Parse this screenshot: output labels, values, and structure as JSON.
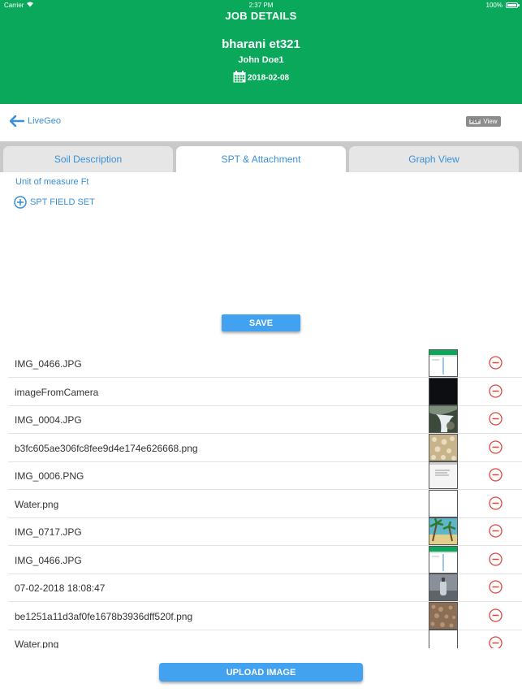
{
  "status_bar": {
    "carrier": "Carrier",
    "time": "2:37 PM",
    "battery": "100%"
  },
  "header": {
    "title": "JOB DETAILS",
    "job_name": "bharani et321",
    "user": "John Doe1",
    "date": "2018-02-08"
  },
  "nav": {
    "back_label": "LiveGeo",
    "pdf_label": "PDF",
    "view_label": "View"
  },
  "tabs": [
    {
      "label": "Soil Description",
      "active": false
    },
    {
      "label": "SPT & Attachment",
      "active": true
    },
    {
      "label": "Graph View",
      "active": false
    }
  ],
  "unit_label": "Unit of measure Ft",
  "spt_field_set_label": "SPT FIELD SET",
  "save_label": "SAVE",
  "attachments": [
    {
      "name": "IMG_0466.JPG",
      "thumb": "screenshot-green"
    },
    {
      "name": "imageFromCamera",
      "thumb": "dark"
    },
    {
      "name": "IMG_0004.JPG",
      "thumb": "waterfall"
    },
    {
      "name": "b3fc605ae306fc8fee9d4e174e626668.png",
      "thumb": "sand"
    },
    {
      "name": "IMG_0006.PNG",
      "thumb": "screenshot-gray"
    },
    {
      "name": "Water.png",
      "thumb": "blank"
    },
    {
      "name": "IMG_0717.JPG",
      "thumb": "beach"
    },
    {
      "name": "IMG_0466.JPG",
      "thumb": "screenshot-green"
    },
    {
      "name": "07-02-2018 18:08:47",
      "thumb": "bottle"
    },
    {
      "name": "be1251a11d3af0fe1678b3936dff520f.png",
      "thumb": "gravel"
    },
    {
      "name": "Water.png",
      "thumb": "blank"
    }
  ],
  "upload_label": "UPLOAD IMAGE",
  "colors": {
    "header_green": "#0aa85a",
    "accent_blue": "#3a8fd8",
    "button_blue": "#42a2f0",
    "delete_red": "#e0453d"
  }
}
